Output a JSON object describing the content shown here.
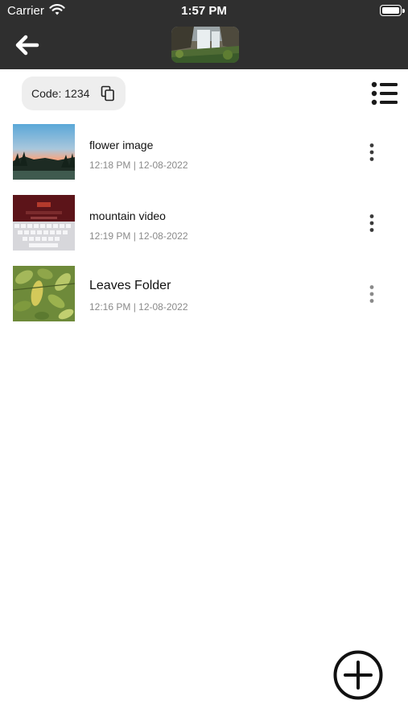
{
  "status_bar": {
    "carrier": "Carrier",
    "time": "1:57 PM"
  },
  "header": {
    "back_icon": "arrow-left-icon",
    "hero_image": "waterfall-landscape"
  },
  "code_chip": {
    "label": "Code: 1234",
    "icon": "copy-icon"
  },
  "view_toggle": {
    "icon": "list-view-icon"
  },
  "items": [
    {
      "title": "flower image",
      "timestamp": "12:18 PM | 12-08-2022",
      "thumbnail": "sunset-sky",
      "menu_icon": "more-vertical-icon"
    },
    {
      "title": "mountain video",
      "timestamp": "12:19 PM | 12-08-2022",
      "thumbnail": "keyboard-screenshot",
      "menu_icon": "more-vertical-icon"
    },
    {
      "title": "Leaves Folder",
      "timestamp": "12:16 PM | 12-08-2022",
      "thumbnail": "green-leaves",
      "menu_icon": "more-vertical-icon"
    }
  ],
  "fab": {
    "icon": "plus-circle-icon"
  },
  "colors": {
    "header_bg": "#2f2f2f",
    "chip_bg": "#eeeeee",
    "meta_text": "#8a8a8a",
    "icon_dark": "#1a1a1a"
  }
}
